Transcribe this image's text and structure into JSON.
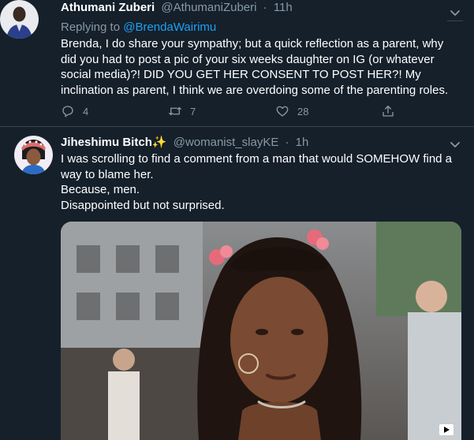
{
  "tweet1": {
    "name": "Athumani Zuberi",
    "handle": "@AthumaniZuberi",
    "separator": "·",
    "time": "11h",
    "replying_label": "Replying to",
    "replying_handle": "@BrendaWairimu",
    "text": "Brenda, I do share your sympathy; but a quick reflection as a parent, why did you had to post a pic of your six weeks daughter on IG (or whatever social media)?! DID YOU GET HER CONSENT TO POST HER?! My inclination as parent, I think we are overdoing some of the parenting roles.",
    "reply_count": "4",
    "retweet_count": "7",
    "like_count": "28"
  },
  "tweet2": {
    "name": "Jiheshimu Bitch",
    "name_emoji": "✨",
    "handle": "@womanist_slayKE",
    "separator": "·",
    "time": "1h",
    "lines": [
      "I was scrolling to find a comment from a man that would SOMEHOW find a way to blame her.",
      "Because, men.",
      "Disappointed but not surprised."
    ]
  },
  "colors": {
    "background": "#15202b",
    "secondary_text": "#8899a6",
    "link": "#1da1f2",
    "divider": "#38444d"
  },
  "icons": {
    "reply": "reply-icon",
    "retweet": "retweet-icon",
    "like": "heart-icon",
    "share": "share-icon",
    "more": "chevron-down-icon"
  }
}
